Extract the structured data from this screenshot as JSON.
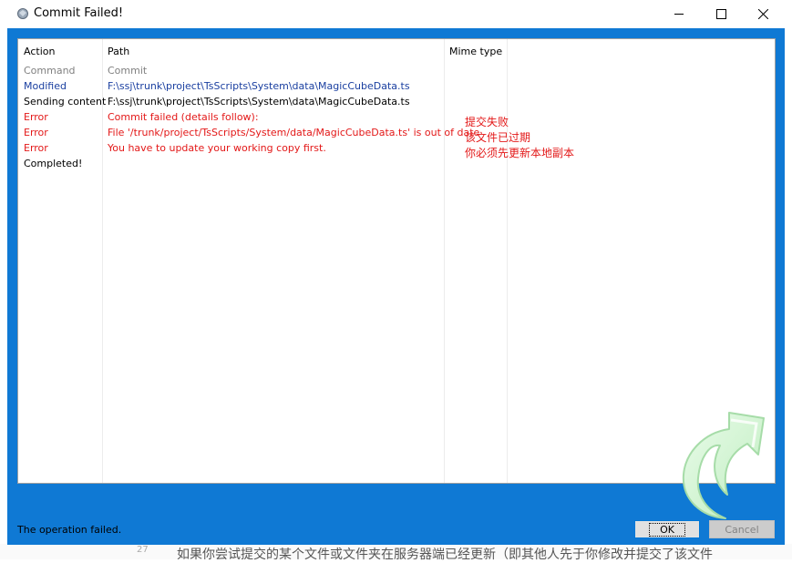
{
  "window": {
    "title": "Commit Failed!",
    "controls": {
      "minimize": "minimize",
      "maximize": "maximize",
      "close": "close"
    }
  },
  "columns": {
    "action": "Action",
    "path": "Path",
    "mime": "Mime type"
  },
  "rows": [
    {
      "action": "Command",
      "path": "Commit",
      "color": "#808080"
    },
    {
      "action": "Modified",
      "path": "F:\\ssj\\trunk\\project\\TsScripts\\System\\data\\MagicCubeData.ts",
      "color": "#1a3fa0"
    },
    {
      "action": "Sending content",
      "path": "F:\\ssj\\trunk\\project\\TsScripts\\System\\data\\MagicCubeData.ts",
      "color": "#000000"
    },
    {
      "action": "Error",
      "path": "Commit failed (details follow):",
      "color": "#e31818"
    },
    {
      "action": "Error",
      "path": "File '/trunk/project/TsScripts/System/data/MagicCubeData.ts' is out of date",
      "color": "#e31818"
    },
    {
      "action": "Error",
      "path": "You have to update your working copy first.",
      "color": "#e31818"
    },
    {
      "action": "Completed!",
      "path": "",
      "color": "#000000"
    }
  ],
  "annotations": [
    "提交失败",
    "该文件已过期",
    "你必须先更新本地副本"
  ],
  "status": "The operation failed.",
  "buttons": {
    "ok": "OK",
    "cancel": "Cancel"
  },
  "background": {
    "line_number": "27",
    "text": "如果你尝试提交的某个文件或文件夹在服务器端已经更新（即其他人先于你修改并提交了该文件"
  },
  "colors": {
    "frame": "#0f79d4",
    "error": "#e31818",
    "modified": "#1a3fa0"
  }
}
